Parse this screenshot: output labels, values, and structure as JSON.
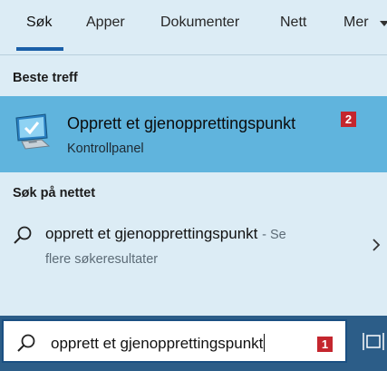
{
  "tabs": [
    {
      "label": "Søk",
      "active": true
    },
    {
      "label": "Apper"
    },
    {
      "label": "Dokumenter"
    },
    {
      "label": "Nett"
    },
    {
      "label": "Mer"
    }
  ],
  "best_match": {
    "section_title": "Beste treff",
    "title": "Opprett et gjenopprettingspunkt",
    "subtitle": "Kontrollpanel",
    "icon": "monitor-check-icon",
    "badge": "2"
  },
  "web_search": {
    "section_title": "Søk på nettet",
    "query": "opprett et gjenopprettingspunkt",
    "hint_line1": "- Se",
    "hint_line2": "flere søkeresultater",
    "icon": "search-icon"
  },
  "search_box": {
    "value": "opprett et gjenopprettingspunkt",
    "badge": "1",
    "icon": "search-icon"
  },
  "taskbar": {
    "icon": "task-view-icon"
  },
  "colors": {
    "panel_bg": "#dcecf5",
    "selected_bg": "#60b4dd",
    "accent": "#1a5fa8",
    "badge": "#c4262e",
    "taskbar": "#2c5d88"
  }
}
